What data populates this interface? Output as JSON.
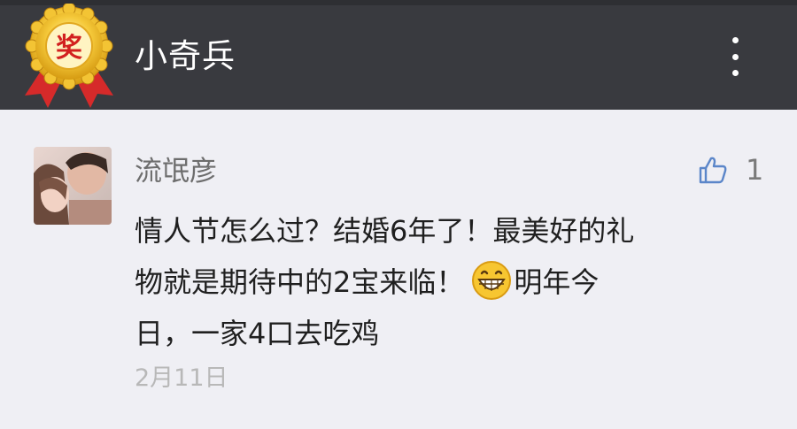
{
  "header": {
    "title": "小奇兵",
    "badge_char": "奖",
    "badge_icon": "award-medal-icon",
    "menu_icon": "more-vertical-icon"
  },
  "comment": {
    "nickname": "流氓彦",
    "avatar_icon": "couple-photo-avatar",
    "like_icon": "thumbs-up-icon",
    "like_count": "1",
    "content_line1": "情人节怎么过？结婚6年了！最美好的礼",
    "content_line2a": "物就是期待中的2宝来临！",
    "emoji_icon": "grinning-face-emoji",
    "content_line2b": "明年今",
    "content_line3": "日，一家4口去吃鸡",
    "date": "2月11日"
  },
  "colors": {
    "header_bg": "#393a3f",
    "page_bg": "#efeff4",
    "accent_blue": "#5b86c9"
  }
}
